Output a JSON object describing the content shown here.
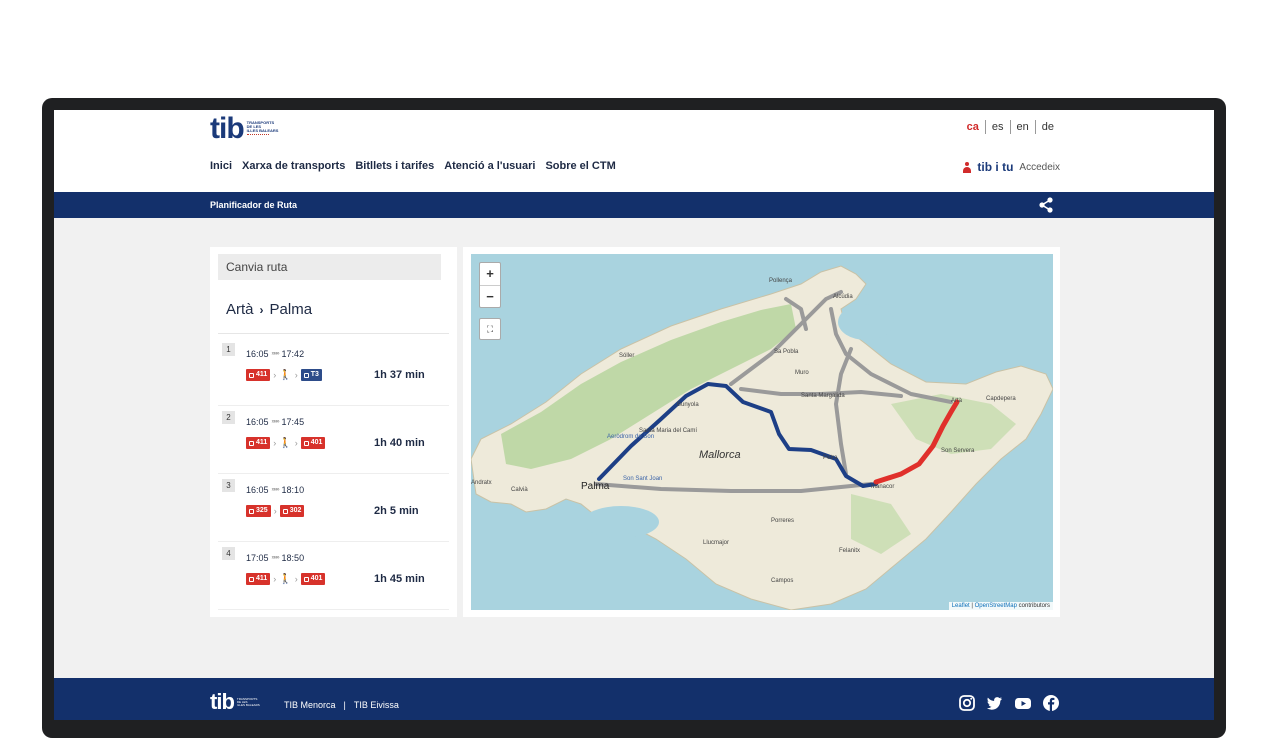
{
  "header": {
    "logo": {
      "text": "tib",
      "sub_lines": [
        "TRANSPORTS",
        "DE LES",
        "ILLES BALEARS"
      ]
    },
    "languages": [
      {
        "code": "ca",
        "active": true
      },
      {
        "code": "es",
        "active": false
      },
      {
        "code": "en",
        "active": false
      },
      {
        "code": "de",
        "active": false
      }
    ],
    "nav": [
      "Inici",
      "Xarxa de transports",
      "Bitllets i tarifes",
      "Atenció a l'usuari",
      "Sobre el CTM"
    ],
    "account": {
      "brand": "tib i tu",
      "login": "Accedeix",
      "icon": "person-icon"
    }
  },
  "subbar": {
    "title": "Planificador de Ruta",
    "share_icon": "share-icon"
  },
  "planner": {
    "change_route": "Canvia ruta",
    "origin": "Artà",
    "destination": "Palma",
    "separator_icon": "chevron-right-icon",
    "trips": [
      {
        "num": "1",
        "depart": "16:05",
        "arrive": "17:42",
        "duration": "1h 37 min",
        "legs": [
          {
            "type": "bus",
            "line": "411",
            "color": "red"
          },
          {
            "type": "walk"
          },
          {
            "type": "bus",
            "line": "T3",
            "color": "blue"
          }
        ]
      },
      {
        "num": "2",
        "depart": "16:05",
        "arrive": "17:45",
        "duration": "1h 40 min",
        "legs": [
          {
            "type": "bus",
            "line": "411",
            "color": "red"
          },
          {
            "type": "walk"
          },
          {
            "type": "bus",
            "line": "401",
            "color": "red"
          }
        ]
      },
      {
        "num": "3",
        "depart": "16:05",
        "arrive": "18:10",
        "duration": "2h 5 min",
        "legs": [
          {
            "type": "bus",
            "line": "325",
            "color": "red"
          },
          {
            "type": "bus",
            "line": "302",
            "color": "red"
          }
        ]
      },
      {
        "num": "4",
        "depart": "17:05",
        "arrive": "18:50",
        "duration": "1h 45 min",
        "legs": [
          {
            "type": "bus",
            "line": "411",
            "color": "red"
          },
          {
            "type": "walk"
          },
          {
            "type": "bus",
            "line": "401",
            "color": "red"
          }
        ]
      }
    ]
  },
  "map": {
    "zoom_in": "+",
    "zoom_out": "−",
    "fullscreen_icon": "fullscreen-icon",
    "attribution": {
      "leaflet": "Leaflet",
      "sep": " | ",
      "osm": "OpenStreetMap",
      "suffix": " contributors"
    },
    "labels": {
      "island": "Mallorca",
      "palma": "Palma",
      "pollensa": "Pollença",
      "alcudia": "Alcúdia",
      "soller": "Sóller",
      "sapobla": "Sa Pobla",
      "muro": "Muro",
      "santamargalida": "Santa Margalida",
      "arta": "Artà",
      "capdepera": "Capdepera",
      "sonservera": "Son Servera",
      "manacor": "Manacor",
      "bunyola": "Bunyola",
      "santamaria": "Santa Maria del Camí",
      "aerodrom": "Aeròdrom de Son",
      "sonsant": "Son Sant Joan",
      "calvia": "Calvià",
      "andratx": "Andratx",
      "petra": "Petra",
      "porreres": "Porreres",
      "llucmajor": "Llucmajor",
      "felanitx": "Felanitx",
      "campos": "Campos"
    },
    "colors": {
      "sea": "#a9d3df",
      "land": "#eeeada",
      "route_blue": "#1d3f86",
      "route_red": "#e0302b",
      "route_gray": "#9a9a9a"
    }
  },
  "footer": {
    "logo": {
      "text": "tib",
      "sub_lines": [
        "TRANSPORTS",
        "DE LES",
        "ILLES BALEARS"
      ]
    },
    "links": [
      "TIB Menorca",
      "TIB Eivissa"
    ],
    "link_separator": "|",
    "social_icons": [
      "instagram-icon",
      "twitter-icon",
      "youtube-icon",
      "facebook-icon"
    ]
  }
}
